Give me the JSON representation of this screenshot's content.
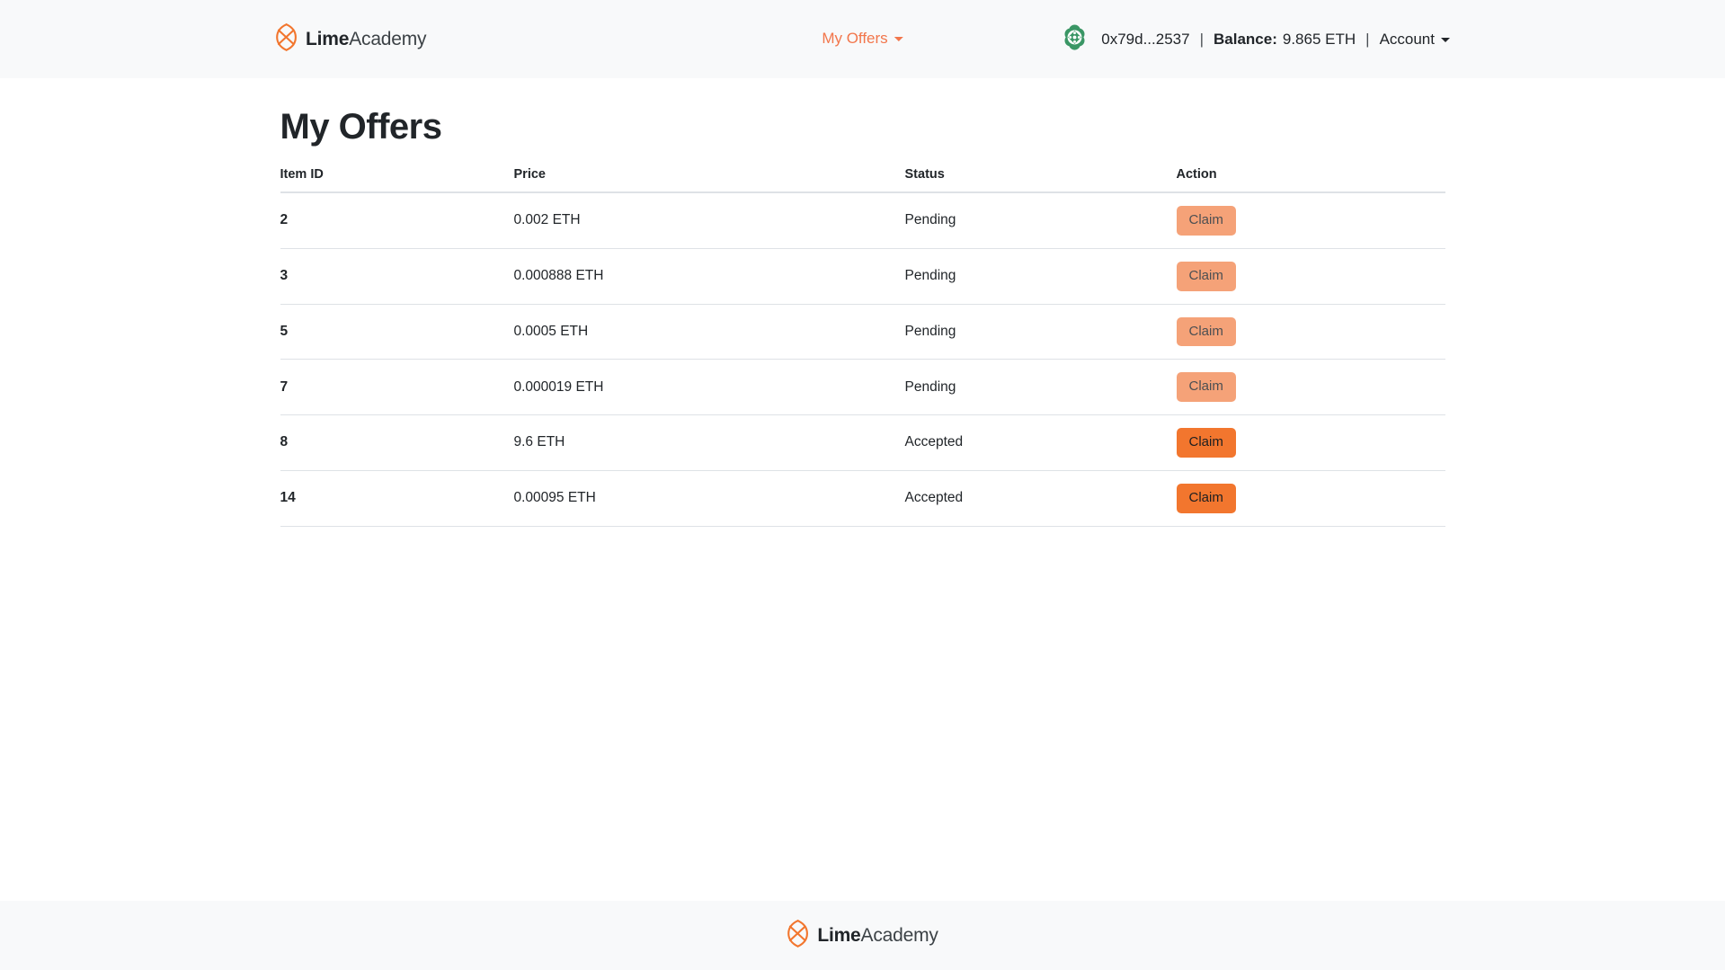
{
  "brand": {
    "name_bold": "Lime",
    "name_light": "Academy",
    "logo_icon": "lime-academy-logo-icon",
    "accent_color": "#f2762e"
  },
  "navbar": {
    "nav_link_label": "My Offers",
    "nav_link_caret_icon": "chevron-down-icon",
    "wallet": {
      "identicon": "wallet-identicon",
      "address": "0x79d...2537",
      "separator": "|",
      "balance_label": "Balance:",
      "balance_value": "9.865 ETH",
      "account_label": "Account",
      "account_caret_icon": "chevron-down-icon"
    }
  },
  "main": {
    "page_title": "My Offers",
    "table": {
      "columns": [
        "Item ID",
        "Price",
        "Status",
        "Action"
      ],
      "rows": [
        {
          "item_id": "2",
          "price": "0.002 ETH",
          "status": "Pending",
          "action_label": "Claim",
          "action_enabled": false
        },
        {
          "item_id": "3",
          "price": "0.000888 ETH",
          "status": "Pending",
          "action_label": "Claim",
          "action_enabled": false
        },
        {
          "item_id": "5",
          "price": "0.0005 ETH",
          "status": "Pending",
          "action_label": "Claim",
          "action_enabled": false
        },
        {
          "item_id": "7",
          "price": "0.000019 ETH",
          "status": "Pending",
          "action_label": "Claim",
          "action_enabled": false
        },
        {
          "item_id": "8",
          "price": "9.6 ETH",
          "status": "Accepted",
          "action_label": "Claim",
          "action_enabled": true
        },
        {
          "item_id": "14",
          "price": "0.00095 ETH",
          "status": "Accepted",
          "action_label": "Claim",
          "action_enabled": true
        }
      ]
    }
  },
  "footer": {
    "name_bold": "Lime",
    "name_light": "Academy",
    "logo_icon": "lime-academy-logo-icon"
  }
}
